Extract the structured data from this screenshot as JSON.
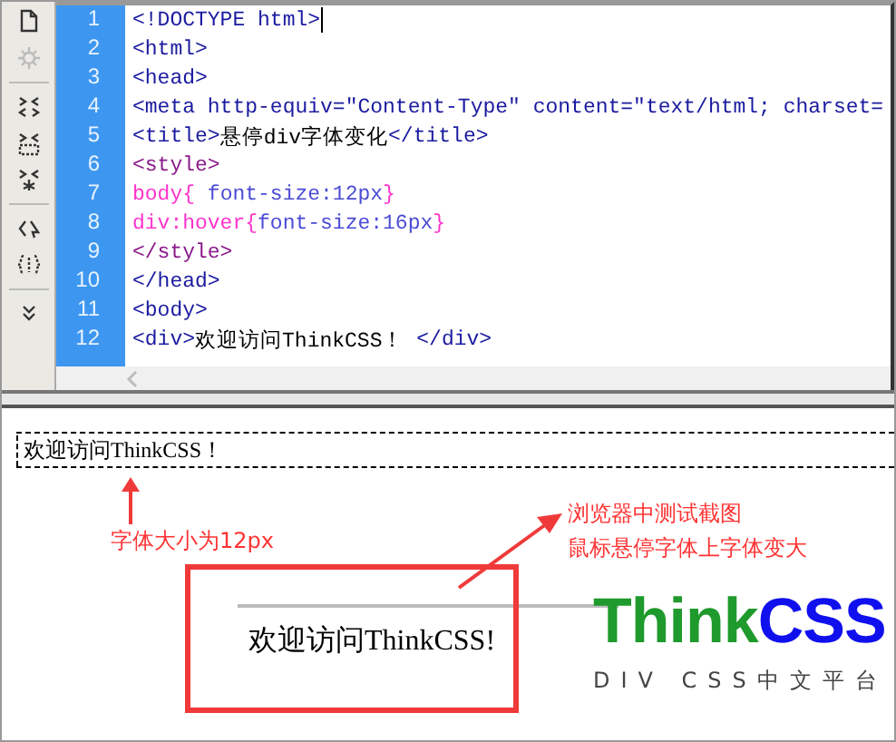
{
  "code_lines": [
    {
      "number": "1",
      "segments": [
        {
          "kind": "tag",
          "text": "<!DOCTYPE html>"
        }
      ],
      "cursor": true
    },
    {
      "number": "2",
      "segments": [
        {
          "kind": "tag",
          "text": "<html>"
        }
      ],
      "cursor": false
    },
    {
      "number": "3",
      "segments": [
        {
          "kind": "tag",
          "text": "<head>"
        }
      ],
      "cursor": false
    },
    {
      "number": "4",
      "segments": [
        {
          "kind": "tag",
          "text": "<meta http-equiv=\"Content-Type\" content=\"text/html; charset="
        }
      ],
      "cursor": false
    },
    {
      "number": "5",
      "segments": [
        {
          "kind": "tag",
          "text": "<title>"
        },
        {
          "kind": "text",
          "text": "悬停div字体变化"
        },
        {
          "kind": "tag",
          "text": "</title>"
        }
      ],
      "cursor": false
    },
    {
      "number": "6",
      "segments": [
        {
          "kind": "style",
          "text": "<style>"
        }
      ],
      "cursor": false
    },
    {
      "number": "7",
      "segments": [
        {
          "kind": "selector",
          "text": "body{ "
        },
        {
          "kind": "property",
          "text": "font-size:12px"
        },
        {
          "kind": "selector",
          "text": "}"
        }
      ],
      "cursor": false
    },
    {
      "number": "8",
      "segments": [
        {
          "kind": "selector",
          "text": "div:hover{"
        },
        {
          "kind": "property",
          "text": "font-size:16px"
        },
        {
          "kind": "selector",
          "text": "}"
        }
      ],
      "cursor": false
    },
    {
      "number": "9",
      "segments": [
        {
          "kind": "style",
          "text": "</style>"
        }
      ],
      "cursor": false
    },
    {
      "number": "10",
      "segments": [
        {
          "kind": "tag",
          "text": "</head>"
        }
      ],
      "cursor": false
    },
    {
      "number": "11",
      "segments": [
        {
          "kind": "tag",
          "text": "<body>"
        }
      ],
      "cursor": false
    },
    {
      "number": "12",
      "segments": [
        {
          "kind": "tag",
          "text": "<div>"
        },
        {
          "kind": "text",
          "text": "欢迎访问ThinkCSS！"
        },
        {
          "kind": "tag",
          "text": " </div>"
        }
      ],
      "cursor": false
    }
  ],
  "preview": {
    "small_text": "欢迎访问ThinkCSS！",
    "large_text": "欢迎访问ThinkCSS!"
  },
  "annotations": [
    {
      "kind": "size",
      "lines": [
        "字体大小为12px"
      ]
    },
    {
      "kind": "hover",
      "lines": [
        "浏览器中测试截图",
        "鼠标悬停字体上字体变大"
      ]
    }
  ],
  "logo": {
    "parts": [
      {
        "text": "Think",
        "color": "#1f9a2c"
      },
      {
        "text": "CSS",
        "color": "#1010ee"
      }
    ],
    "tagline": "DIV CSS中文平台"
  }
}
